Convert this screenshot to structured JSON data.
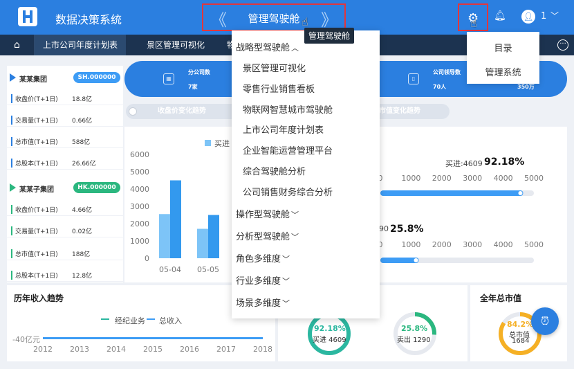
{
  "header": {
    "app_title": "数据决策系统",
    "cockpit_title": "管理驾驶舱",
    "tooltip": "管理驾驶舱",
    "user_count": "1"
  },
  "nav": {
    "tabs": [
      {
        "label": "上市公司年度计划表",
        "active": true
      },
      {
        "label": "景区管理可视化",
        "active": false
      },
      {
        "label": "物",
        "active": false
      }
    ]
  },
  "left_panel": {
    "groups": [
      {
        "name": "某某集团",
        "badge": "SH.000000",
        "badge_color": "#3d9cf5",
        "stats": [
          {
            "label": "收盘价(T+1日)",
            "value": "18.8亿"
          },
          {
            "label": "交易量(T+1日)",
            "value": "0.66亿"
          },
          {
            "label": "总市值(T+1日)",
            "value": "588亿"
          },
          {
            "label": "总股本(T+1日)",
            "value": "26.66亿"
          }
        ]
      },
      {
        "name": "某某子集团",
        "badge": "HK.000000",
        "badge_color": "#2bb77f",
        "stats": [
          {
            "label": "收盘价(T+1日)",
            "value": "4.66亿"
          },
          {
            "label": "交易量(T+1日)",
            "value": "0.02亿"
          },
          {
            "label": "总市值(T+1日)",
            "value": "188亿"
          },
          {
            "label": "总股本(T+1日)",
            "value": "12.8亿"
          }
        ]
      }
    ]
  },
  "summary": {
    "items": [
      {
        "label": "分公司数",
        "value": "7家"
      },
      {
        "label": "公司领导数",
        "value": "70人"
      },
      {
        "label": "数",
        "value": "350万"
      }
    ]
  },
  "pills": {
    "left": "收盘价变化趋势",
    "right": "总市值变化趋势"
  },
  "bar_chart": {
    "legend": "买进",
    "chart_data": {
      "type": "bar",
      "categories": [
        "05-04",
        "05-05"
      ],
      "series": [
        {
          "name": "买进",
          "values": [
            2550,
            1700
          ],
          "color": "#7dc4f7"
        },
        {
          "values": [
            4500,
            2500
          ],
          "color": "#3399ee"
        }
      ],
      "ylim": [
        0,
        6000
      ],
      "yticks": [
        0,
        1000,
        2000,
        3000,
        4000,
        5000,
        6000
      ]
    }
  },
  "progress": {
    "axis_ticks": [
      "0",
      "1000",
      "2000",
      "3000",
      "4000",
      "5000"
    ],
    "bars": [
      {
        "caption": "买进:4609",
        "percent": "92.18%",
        "fraction": 0.9218
      },
      {
        "caption": "90",
        "percent": "25.8%",
        "fraction": 0.258
      }
    ]
  },
  "cards": {
    "income_trend": {
      "title": "历年收入趋势",
      "legend": [
        "经纪业务",
        "总收入"
      ],
      "y_label": "-40亿元",
      "years": [
        "2012",
        "2013",
        "2014",
        "2015",
        "2016",
        "2017",
        "2018"
      ]
    },
    "rings": [
      {
        "percent": "92.18%",
        "label": "买进 4609",
        "color": "#2bb7a0",
        "fraction": 0.9218
      },
      {
        "percent": "25.8%",
        "label": "卖出 1290",
        "color": "#2bb77f",
        "fraction": 0.258
      }
    ],
    "market_value": {
      "title": "全年总市值",
      "percent": "84.2%",
      "label": "总市值",
      "value": "1684",
      "fraction": 0.842
    }
  },
  "dropdown": {
    "items": [
      {
        "label": "战略型驾驶舱",
        "type": "group",
        "caret": "^"
      },
      {
        "label": "景区管理可视化",
        "type": "child"
      },
      {
        "label": "零售行业销售看板",
        "type": "child"
      },
      {
        "label": "物联网智慧城市驾驶舱",
        "type": "child"
      },
      {
        "label": "上市公司年度计划表",
        "type": "child"
      },
      {
        "label": "企业智能运营管理平台",
        "type": "child"
      },
      {
        "label": "综合驾驶舱分析",
        "type": "child"
      },
      {
        "label": "公司销售财务综合分析",
        "type": "child"
      },
      {
        "label": "操作型驾驶舱",
        "type": "group",
        "caret": "v"
      },
      {
        "label": "分析型驾驶舱",
        "type": "group",
        "caret": "v"
      },
      {
        "label": "角色多维度",
        "type": "group",
        "caret": "v"
      },
      {
        "label": "行业多维度",
        "type": "group",
        "caret": "v"
      },
      {
        "label": "场景多维度",
        "type": "group",
        "caret": "v"
      }
    ]
  },
  "gear_menu": {
    "items": [
      "目录",
      "管理系统"
    ]
  },
  "colors": {
    "brand": "#2b7fe0",
    "nav": "#1c3350",
    "highlight_border": "#e2363c"
  }
}
